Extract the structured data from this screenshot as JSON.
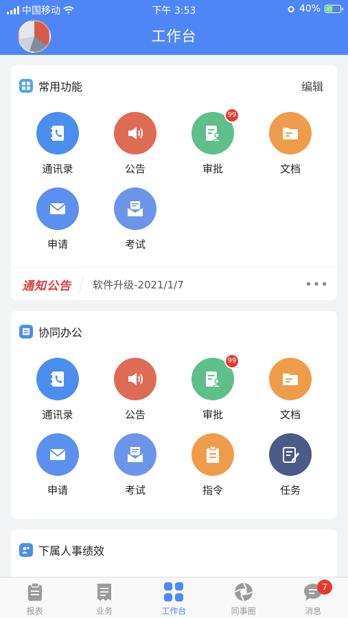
{
  "status": {
    "carrier": "中国移动",
    "time": "下午 3:53",
    "battery": "40%"
  },
  "header": {
    "title": "工作台"
  },
  "common": {
    "title": "常用功能",
    "edit_label": "编辑",
    "items": [
      {
        "label": "通讯录",
        "icon": "contacts-icon",
        "color": "#4a8ef0"
      },
      {
        "label": "公告",
        "icon": "speaker-icon",
        "color": "#dd6b55"
      },
      {
        "label": "审批",
        "icon": "approval-icon",
        "color": "#5fbf8a",
        "badge": "99"
      },
      {
        "label": "文档",
        "icon": "folder-icon",
        "color": "#ef9c4a"
      },
      {
        "label": "申请",
        "icon": "mail-icon",
        "color": "#5b8ff0"
      },
      {
        "label": "考试",
        "icon": "exam-icon",
        "color": "#6c95ea"
      }
    ],
    "notice": {
      "brand": "通知公告",
      "text": "软件升级-2021/1/7",
      "more": "•••"
    }
  },
  "collab": {
    "title": "协同办公",
    "items": [
      {
        "label": "通讯录",
        "icon": "contacts-icon",
        "color": "#4a8ef0"
      },
      {
        "label": "公告",
        "icon": "speaker-icon",
        "color": "#dd6b55"
      },
      {
        "label": "审批",
        "icon": "approval-icon",
        "color": "#5fbf8a",
        "badge": "99"
      },
      {
        "label": "文档",
        "icon": "folder-icon",
        "color": "#ef9c4a"
      },
      {
        "label": "申请",
        "icon": "mail-icon",
        "color": "#5b8ff0"
      },
      {
        "label": "考试",
        "icon": "exam-icon",
        "color": "#6c95ea"
      },
      {
        "label": "指令",
        "icon": "clipboard-icon",
        "color": "#ef9c4a"
      },
      {
        "label": "任务",
        "icon": "task-icon",
        "color": "#4b5a86"
      }
    ]
  },
  "performance": {
    "title": "下属人事绩效"
  },
  "tabs": [
    {
      "label": "报表",
      "icon": "report-icon"
    },
    {
      "label": "业务",
      "icon": "receipt-icon"
    },
    {
      "label": "工作台",
      "icon": "grid-icon",
      "active": true
    },
    {
      "label": "同事圈",
      "icon": "shutter-icon"
    },
    {
      "label": "消息",
      "icon": "chat-icon",
      "badge": "7"
    }
  ]
}
